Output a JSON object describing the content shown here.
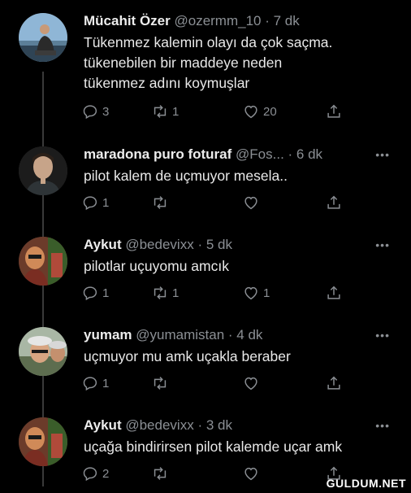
{
  "tweets": [
    {
      "name": "Mücahit Özer",
      "handle": "@ozermm_10",
      "time": "· 7 dk",
      "text": "Tükenmez kalemin olayı da çok saçma.\ntükenebilen bir maddeye neden\ntükenmez adını koymuşlar",
      "replies": "3",
      "retweets": "1",
      "likes": "20"
    },
    {
      "name": "maradona puro foturaf",
      "handle": "@Fos...",
      "time": "· 6 dk",
      "text": "pilot kalem de uçmuyor mesela..",
      "replies": "1",
      "retweets": "",
      "likes": ""
    },
    {
      "name": "Aykut",
      "handle": "@bedevixx",
      "time": "· 5 dk",
      "text": "pilotlar uçuyomu amcık",
      "replies": "1",
      "retweets": "1",
      "likes": "1"
    },
    {
      "name": "yumam",
      "handle": "@yumamistan",
      "time": "· 4 dk",
      "text": "uçmuyor mu amk uçakla beraber",
      "replies": "1",
      "retweets": "",
      "likes": ""
    },
    {
      "name": "Aykut",
      "handle": "@bedevixx",
      "time": "· 3 dk",
      "text": "uçağa bindirirsen pilot kalemde uçar amk",
      "replies": "2",
      "retweets": "",
      "likes": ""
    }
  ],
  "more_label": "•••",
  "watermark": "GULDUM.NET",
  "colors": {
    "background": "#000000",
    "muted": "#8b8f94",
    "text": "#e9e9e9"
  },
  "icons": [
    "reply-icon",
    "retweet-icon",
    "like-icon",
    "share-icon",
    "more-icon"
  ]
}
